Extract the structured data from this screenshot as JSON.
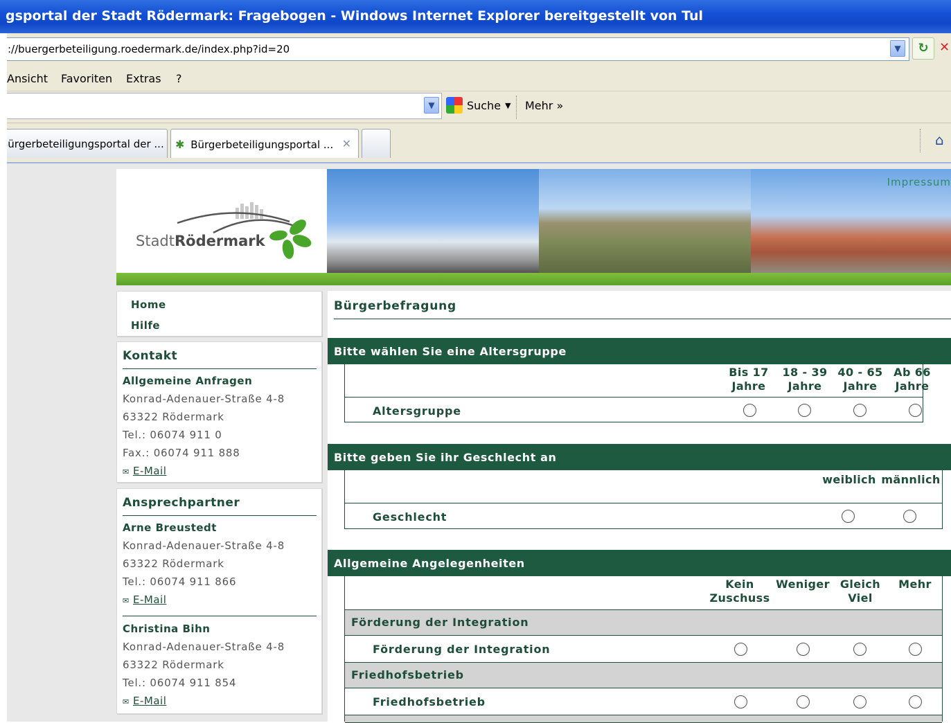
{
  "window": {
    "title": "gsportal der Stadt Rödermark: Fragebogen - Windows Internet Explorer bereitgestellt von Tul",
    "address": "://buergerbeteiligung.roedermark.de/index.php?id=20"
  },
  "menu": [
    "Ansicht",
    "Favoriten",
    "Extras",
    "?"
  ],
  "toolbar": {
    "search_label": "Suche",
    "more_label": "Mehr »"
  },
  "tabs": [
    {
      "label": "Bürgerbeteiligungsportal der ..."
    },
    {
      "label": "Bürgerbeteiligungsportal ..."
    }
  ],
  "header": {
    "logo_prefix": "Stadt",
    "logo_name": "Rödermark",
    "impressum": "Impressum"
  },
  "nav": [
    "Home",
    "Hilfe"
  ],
  "kontakt": {
    "title": "Kontakt",
    "name": "Allgemeine Anfragen",
    "lines": [
      "Konrad-Adenauer-Straße 4-8",
      "63322 Rödermark",
      "Tel.: 06074 911 0",
      "Fax.: 06074 911 888"
    ],
    "mail": "E-Mail"
  },
  "ansprechpartner": {
    "title": "Ansprechpartner",
    "persons": [
      {
        "name": "Arne Breustedt",
        "lines": [
          "Konrad-Adenauer-Straße 4-8",
          "63322 Rödermark",
          "Tel.: 06074 911 866"
        ],
        "mail": "E-Mail"
      },
      {
        "name": "Christina Bihn",
        "lines": [
          "Konrad-Adenauer-Straße 4-8",
          "63322 Rödermark",
          "Tel.: 06074 911 854"
        ],
        "mail": "E-Mail"
      }
    ]
  },
  "content": {
    "title": "Bürgerbefragung",
    "sections": [
      {
        "heading": "Bitte wählen Sie eine Altersgruppe",
        "columns": [
          [
            "Bis 17",
            "Jahre"
          ],
          [
            "18 - 39",
            "Jahre"
          ],
          [
            "40 - 65",
            "Jahre"
          ],
          [
            "Ab 66",
            "Jahre"
          ]
        ],
        "row": "Altersgruppe"
      },
      {
        "heading": "Bitte geben Sie ihr Geschlecht an",
        "columns": [
          [
            "weiblich"
          ],
          [
            "männlich"
          ]
        ],
        "row": "Geschlecht"
      },
      {
        "heading": "Allgemeine Angelegenheiten",
        "columns": [
          [
            "Kein",
            "Zuschuss"
          ],
          [
            "Weniger"
          ],
          [
            "Gleich",
            "Viel"
          ],
          [
            "Mehr"
          ]
        ],
        "groups": [
          {
            "group": "Förderung der Integration",
            "row": "Förderung der Integration"
          },
          {
            "group": "Friedhofsbetrieb",
            "row": "Friedhofsbetrieb"
          }
        ]
      }
    ]
  },
  "colors": {
    "titlebar": "#0f47c8",
    "brand_green": "#1e5a3f",
    "accent_lime": "#6db034"
  }
}
